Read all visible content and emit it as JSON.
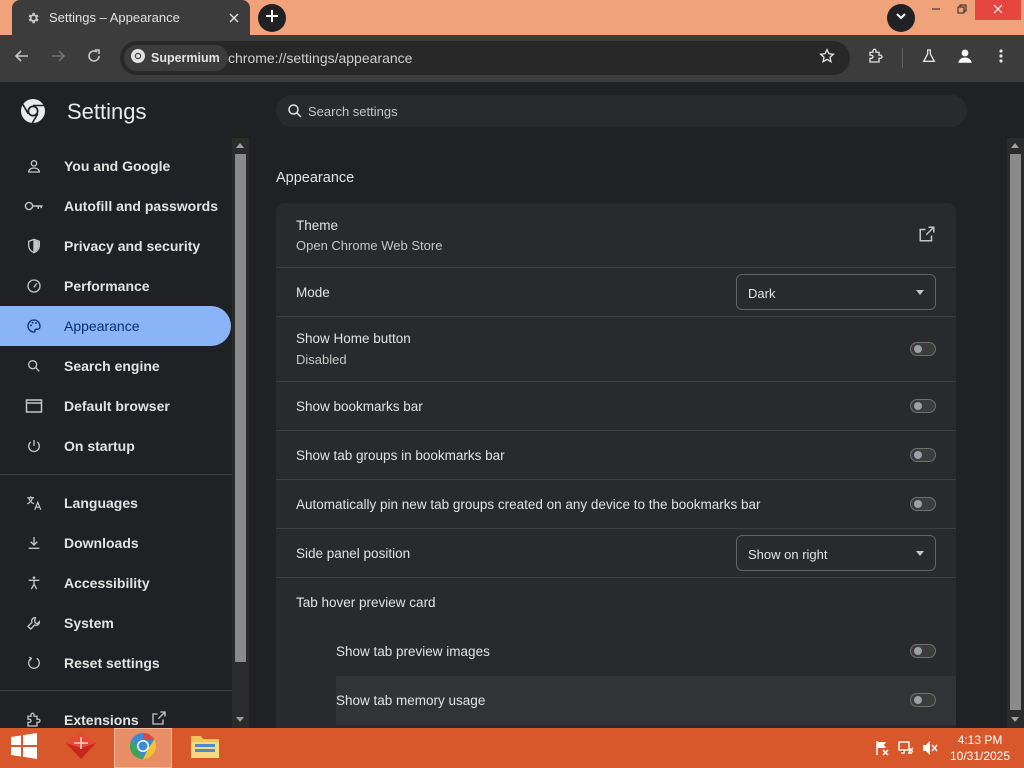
{
  "window": {
    "tab_title": "Settings – Appearance",
    "icons": {
      "tab": "gear-icon",
      "close": "close-icon",
      "new_tab": "plus-icon",
      "tab_search": "chevron-down-icon"
    }
  },
  "toolbar": {
    "site_chip": "Supermium",
    "url": "chrome://settings/appearance",
    "icons": [
      "back-icon",
      "forward-icon",
      "reload-icon",
      "star-icon",
      "extensions-icon",
      "labs-icon",
      "profile-icon",
      "menu-icon"
    ]
  },
  "header": {
    "title": "Settings",
    "search_placeholder": "Search settings"
  },
  "sidebar": {
    "items": [
      {
        "label": "You and Google",
        "icon": "person-icon"
      },
      {
        "label": "Autofill and passwords",
        "icon": "key-icon"
      },
      {
        "label": "Privacy and security",
        "icon": "shield-icon"
      },
      {
        "label": "Performance",
        "icon": "speedometer-icon"
      },
      {
        "label": "Appearance",
        "icon": "palette-icon",
        "active": true
      },
      {
        "label": "Search engine",
        "icon": "search-icon"
      },
      {
        "label": "Default browser",
        "icon": "browser-window-icon"
      },
      {
        "label": "On startup",
        "icon": "power-icon"
      },
      {
        "label": "Languages",
        "icon": "translate-icon"
      },
      {
        "label": "Downloads",
        "icon": "download-icon"
      },
      {
        "label": "Accessibility",
        "icon": "accessibility-icon"
      },
      {
        "label": "System",
        "icon": "wrench-icon"
      },
      {
        "label": "Reset settings",
        "icon": "reset-icon"
      },
      {
        "label": "Extensions",
        "icon": "extensions-icon"
      }
    ]
  },
  "main": {
    "section_title": "Appearance",
    "theme": {
      "label": "Theme",
      "sub": "Open Chrome Web Store"
    },
    "mode": {
      "label": "Mode",
      "value": "Dark"
    },
    "home_button": {
      "label": "Show Home button",
      "sub": "Disabled",
      "enabled": false
    },
    "bookmarks_bar": {
      "label": "Show bookmarks bar",
      "enabled": false
    },
    "tab_groups": {
      "label": "Show tab groups in bookmarks bar",
      "enabled": false
    },
    "auto_pin": {
      "label": "Automatically pin new tab groups created on any device to the bookmarks bar",
      "enabled": false
    },
    "side_panel": {
      "label": "Side panel position",
      "value": "Show on right"
    },
    "hover_card": {
      "label": "Tab hover preview card"
    },
    "preview_images": {
      "label": "Show tab preview images",
      "enabled": false
    },
    "memory_usage": {
      "label": "Show tab memory usage",
      "enabled": false
    }
  },
  "taskbar": {
    "apps": [
      "start-icon",
      "app-icon",
      "chrome-icon",
      "folder-icon"
    ],
    "tray": [
      "flag-icon",
      "network-icon",
      "volume-muted-icon"
    ],
    "time": "4:13 PM",
    "date": "10/31/2025"
  },
  "colors": {
    "accent": "#8ab4f8",
    "titlebar": "#f0a27a",
    "taskbar": "#d8582c",
    "close": "#e5463f"
  }
}
